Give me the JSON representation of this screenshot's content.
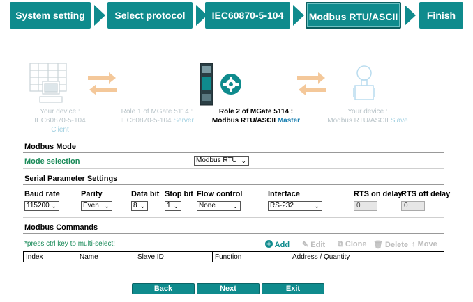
{
  "wizard": {
    "steps": [
      {
        "label": "System setting"
      },
      {
        "label": "Select protocol"
      },
      {
        "label": "IEC60870-5-104"
      },
      {
        "label": "Modbus RTU/ASCII"
      },
      {
        "label": "Finish"
      }
    ]
  },
  "diagram": {
    "left_device": {
      "line1": "Your device :",
      "line2": "IEC60870-5-104",
      "role": "Client"
    },
    "role1": {
      "line1": "Role 1 of MGate 5114 :",
      "line2": "IEC60870-5-104",
      "role": "Server"
    },
    "role2": {
      "line1": "Role 2 of MGate 5114 :",
      "line2": "Modbus RTU/ASCII",
      "role": "Master"
    },
    "right_device": {
      "line1": "Your device :",
      "line2": "Modbus RTU/ASCII",
      "role": "Slave"
    }
  },
  "modbus_mode": {
    "title": "Modbus Mode",
    "mode_label": "Mode selection",
    "mode_value": "Modbus RTU"
  },
  "serial": {
    "title": "Serial Parameter Settings",
    "headers": {
      "baud": "Baud rate",
      "parity": "Parity",
      "data_bit": "Data bit",
      "stop_bit": "Stop bit",
      "flow": "Flow control",
      "interface": "Interface",
      "rts_on": "RTS on delay",
      "rts_off": "RTS off delay"
    },
    "values": {
      "baud": "115200",
      "parity": "Even",
      "data_bit": "8",
      "stop_bit": "1",
      "flow": "None",
      "interface": "RS-232",
      "rts_on": "0",
      "rts_off": "0"
    }
  },
  "commands": {
    "title": "Modbus Commands",
    "hint": "*press ctrl key to multi-select!",
    "actions": {
      "add": "Add",
      "edit": "Edit",
      "clone": "Clone",
      "delete": "Delete",
      "move": "Move"
    },
    "columns": [
      "Index",
      "Name",
      "Slave ID",
      "Function",
      "Address / Quantity"
    ]
  },
  "buttons": {
    "back": "Back",
    "next": "Next",
    "exit": "Exit"
  },
  "colors": {
    "accent": "#0f8b8d",
    "link": "#1a7fb0",
    "mode_label": "#1b8b5a"
  }
}
